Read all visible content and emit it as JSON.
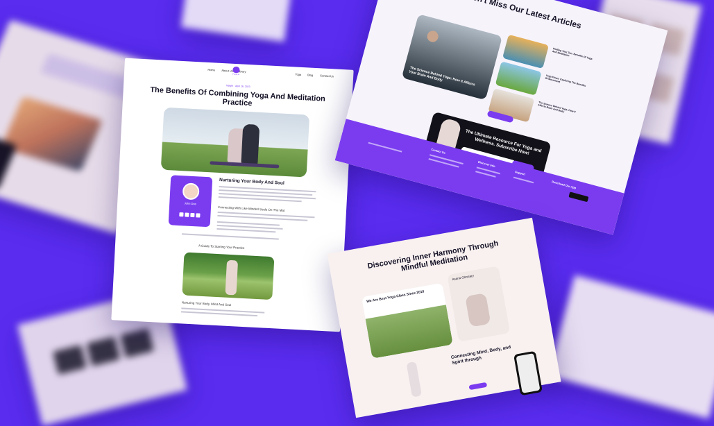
{
  "article": {
    "nav": {
      "home": "Home",
      "about": "About Us",
      "library": "Library",
      "yoga": "Yoga",
      "blog": "Blog",
      "contact": "Contact Us",
      "logo": "YOGA"
    },
    "breadcrumb": "Insight  ·  April 16, 2023",
    "title": "The Benefits Of Combining Yoga And Meditation Practice",
    "author_name": "John Doe",
    "section_title": "Nurturing Your Body And Soul",
    "sub_heading": "Connecting With Like-Minded Souls On The Mat",
    "guide_heading": "A Guide To Starting Your Practice",
    "bottom_heading": "Nurturing Your Body, Mind And Soul"
  },
  "articles_page": {
    "heading": "Don't Miss Our Latest Articles",
    "featured_title": "The Science Behind Yoga: How It Affects Your Brain And Body",
    "card_titles": [
      "Finding Your Zen: Benefits Of Yoga And Meditation",
      "Yoga Flows: Exploring The Benefits Of Movement",
      "The Science Behind Yoga: How It Affects Brain And Body"
    ],
    "newsletter_title": "The Ultimate Resource For Yoga and Wellness. Subscribe Now!",
    "footer_headings": [
      "Contact Us",
      "Discover Info",
      "Support",
      "Download Our App"
    ]
  },
  "discover_page": {
    "title": "Discovering Inner Harmony Through Mindful Meditation",
    "card_left": "We Are Best Yoga Class Since 2010",
    "card_right": "Asana Glossary",
    "section_title": "Connecting Mind, Body, and Spirit through"
  },
  "colors": {
    "background": "#5a2cf0",
    "accent": "#7b3cf0",
    "dark": "#121018"
  }
}
